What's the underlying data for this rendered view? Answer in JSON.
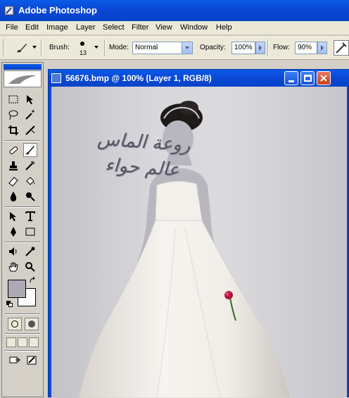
{
  "app": {
    "title": "Adobe Photoshop"
  },
  "menu": [
    "File",
    "Edit",
    "Image",
    "Layer",
    "Select",
    "Filter",
    "View",
    "Window",
    "Help"
  ],
  "options": {
    "brush_label": "Brush:",
    "brush_size": "13",
    "mode_label": "Mode:",
    "mode_value": "Normal",
    "opacity_label": "Opacity:",
    "opacity_value": "100%",
    "flow_label": "Flow:",
    "flow_value": "90%"
  },
  "document": {
    "title": "56676.bmp @ 100% (Layer 1, RGB/8)",
    "watermark_line1": "روعة الماس",
    "watermark_line2": "عالم حواء"
  },
  "colors": {
    "foreground": "#adaab5",
    "background": "#ffffff",
    "xp_blue": "#0a49d6"
  }
}
